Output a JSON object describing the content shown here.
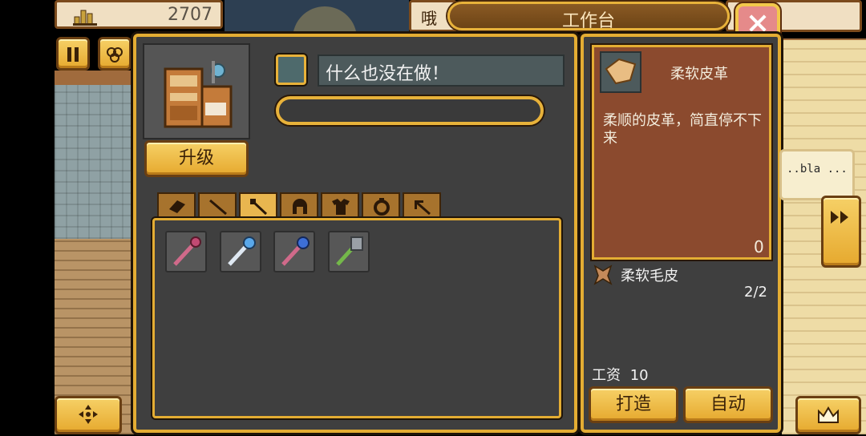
{
  "top": {
    "coins": "2707",
    "left_tab_text": "哦",
    "title": "工作台"
  },
  "left_buttons": {
    "pause_icon": "pause-icon",
    "map_icon": "map-icon"
  },
  "workbench": {
    "status": "什么也没在做！",
    "upgrade_label": "升级",
    "progress": 0,
    "tabs": [
      {
        "icon": "leather-icon",
        "active": false
      },
      {
        "icon": "stick-icon",
        "active": false
      },
      {
        "icon": "wand-icon",
        "active": true
      },
      {
        "icon": "helmet-icon",
        "active": false
      },
      {
        "icon": "armor-icon",
        "active": false
      },
      {
        "icon": "ring-icon",
        "active": false
      },
      {
        "icon": "pickaxe-icon",
        "active": false
      }
    ],
    "slots": [
      {
        "icon": "pink-staff-icon",
        "color": "#d06a8a"
      },
      {
        "icon": "blue-wand-icon",
        "color": "#5aa8ea"
      },
      {
        "icon": "blue-orb-staff-icon",
        "color": "#3d6fd8"
      },
      {
        "icon": "green-mace-icon",
        "color": "#74b84a"
      }
    ]
  },
  "detail": {
    "item_name": "柔软皮革",
    "description": "柔顺的皮革，简直停不下来",
    "owned": "0",
    "material_name": "柔软毛皮",
    "material_count": "2/2",
    "wage_label": "工资",
    "wage_value": "10",
    "craft_label": "打造",
    "auto_label": "自动"
  },
  "side": {
    "speech": "..bla ..."
  },
  "colors": {
    "gold": "#e4ad33",
    "panel": "#3f3f3f",
    "desc_bg": "#8b4a2e",
    "close": "#e58a8a"
  }
}
